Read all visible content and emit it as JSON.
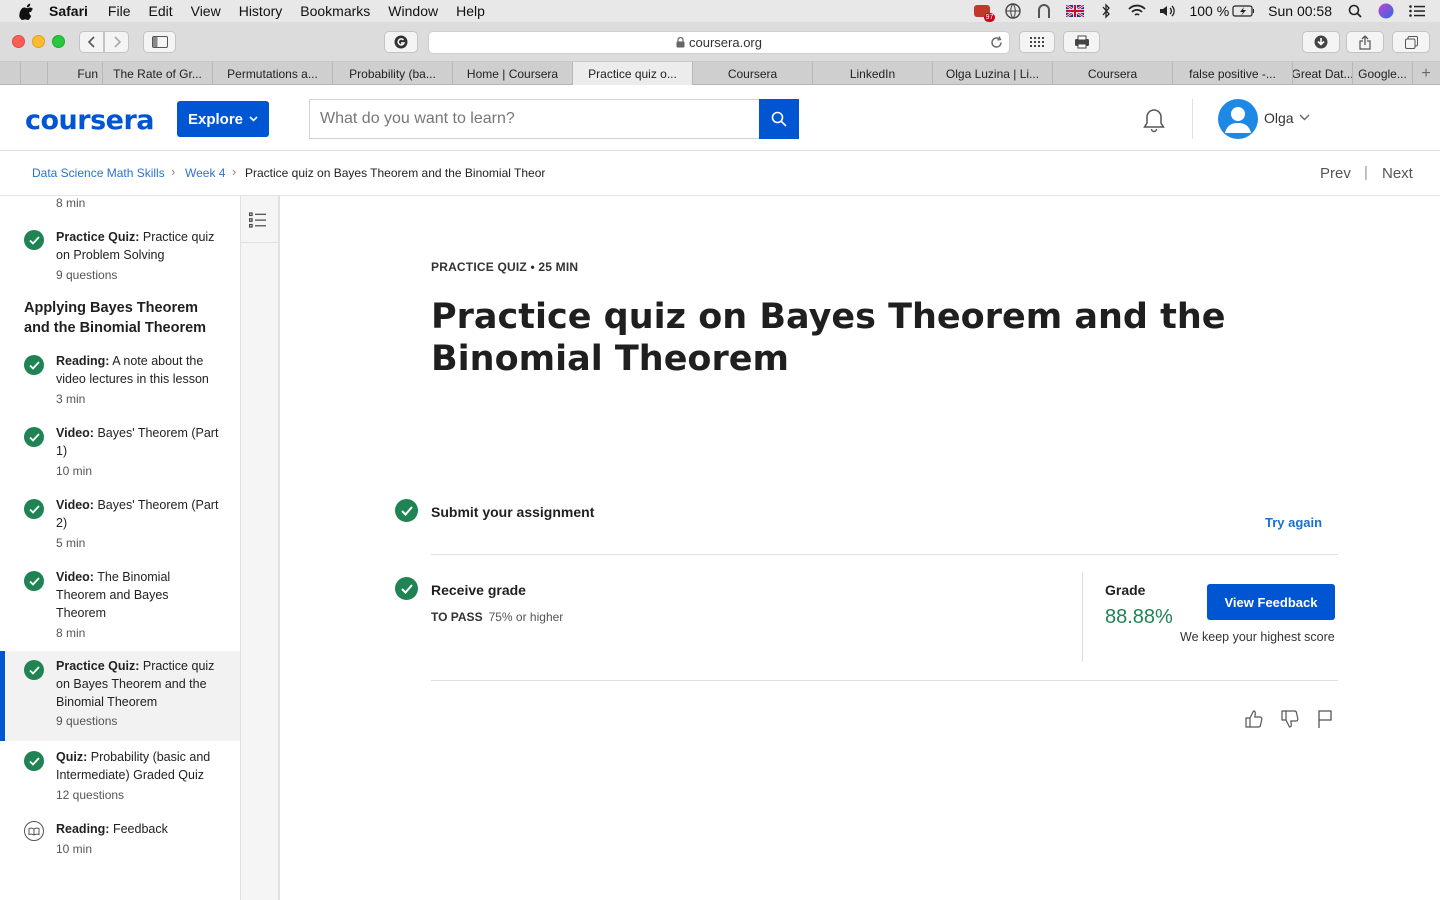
{
  "menubar": {
    "app": "Safari",
    "items": [
      "File",
      "Edit",
      "View",
      "History",
      "Bookmarks",
      "Window",
      "Help"
    ],
    "battery": "100 %",
    "clock": "Sun 00:58",
    "notif_badge": "97"
  },
  "browser": {
    "url": "coursera.org",
    "tabs": [
      {
        "label": "Fun"
      },
      {
        "label": "The Rate of Gr..."
      },
      {
        "label": "Permutations a..."
      },
      {
        "label": "Probability (ba..."
      },
      {
        "label": "Home | Coursera"
      },
      {
        "label": "Practice quiz o..."
      },
      {
        "label": "Coursera"
      },
      {
        "label": "LinkedIn"
      },
      {
        "label": "Olga Luzina | Li..."
      },
      {
        "label": "Coursera"
      },
      {
        "label": "false positive -..."
      },
      {
        "label": "Great Dat..."
      },
      {
        "label": "Google..."
      }
    ],
    "new_tab": "+"
  },
  "header": {
    "logo": "coursera",
    "explore": "Explore",
    "search_placeholder": "What do you want to learn?",
    "user_name": "Olga"
  },
  "breadcrumb": {
    "course": "Data Science Math Skills",
    "week": "Week 4",
    "current": "Practice quiz on Bayes Theorem and the Binomial Theorem",
    "prev": "Prev",
    "next": "Next"
  },
  "sidebar": {
    "top_meta": "8 min",
    "item_pq1": {
      "type": "Practice Quiz:",
      "title": "Practice quiz on Problem Solving",
      "meta": "9 questions"
    },
    "section_title": "Applying Bayes Theorem and the Binomial Theorem",
    "items": [
      {
        "type": "Reading:",
        "title": "A note about the video lectures in this lesson",
        "meta": "3 min"
      },
      {
        "type": "Video:",
        "title": "Bayes' Theorem (Part 1)",
        "meta": "10 min"
      },
      {
        "type": "Video:",
        "title": "Bayes' Theorem (Part 2)",
        "meta": "5 min"
      },
      {
        "type": "Video:",
        "title": "The Binomial Theorem and Bayes Theorem",
        "meta": "8 min"
      },
      {
        "type": "Practice Quiz:",
        "title": "Practice quiz on Bayes Theorem and the Binomial Theorem",
        "meta": "9 questions"
      },
      {
        "type": "Quiz:",
        "title": "Probability (basic and Intermediate) Graded Quiz",
        "meta": "12 questions"
      },
      {
        "type": "Reading:",
        "title": "Feedback",
        "meta": "10 min"
      }
    ]
  },
  "main": {
    "kicker": "PRACTICE QUIZ • 25 MIN",
    "title": "Practice quiz on Bayes Theorem and the Binomial Theorem",
    "submit_label": "Submit your assignment",
    "try_again": "Try again",
    "receive_label": "Receive grade",
    "to_pass_label": "TO PASS",
    "to_pass_value": "75% or higher",
    "grade_label": "Grade",
    "grade_value": "88.88%",
    "view_feedback": "View Feedback",
    "keep_note": "We keep your highest score"
  },
  "colors": {
    "brand_blue": "#0056d2",
    "success_green": "#1f8354",
    "link_blue": "#2a73cc"
  }
}
